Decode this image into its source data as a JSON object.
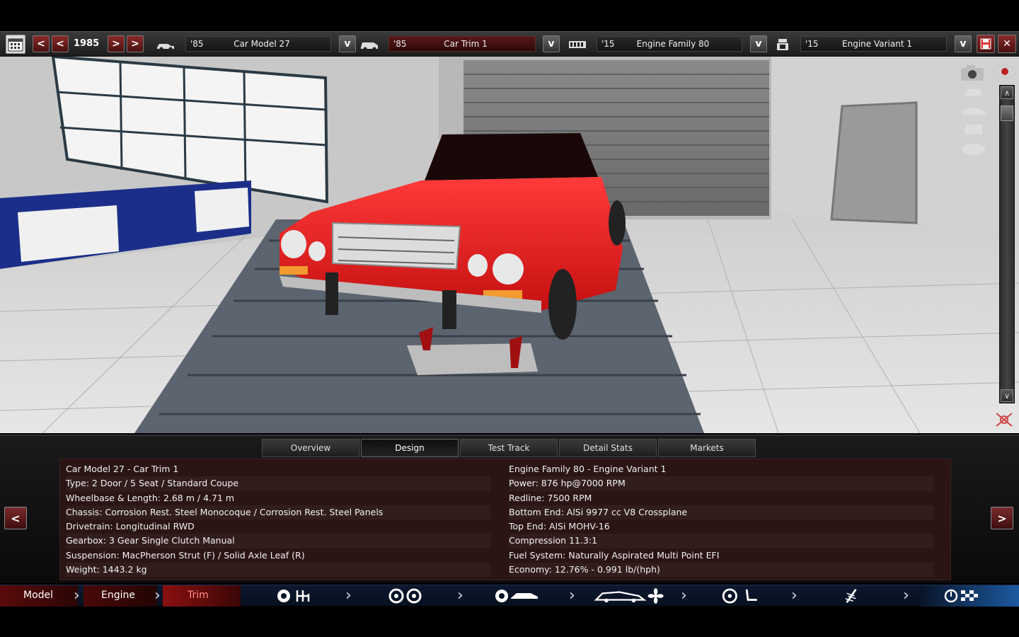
{
  "topbar": {
    "year": "1985",
    "model": {
      "year": "'85",
      "name": "Car Model 27"
    },
    "trim": {
      "year": "'85",
      "name": "Car Trim 1"
    },
    "engine_family": {
      "year": "'15",
      "name": "Engine Family 80"
    },
    "engine_variant": {
      "year": "'15",
      "name": "Engine Variant 1"
    }
  },
  "tabs": [
    {
      "label": "Overview"
    },
    {
      "label": "Design"
    },
    {
      "label": "Test Track"
    },
    {
      "label": "Detail Stats"
    },
    {
      "label": "Markets"
    }
  ],
  "info": {
    "left": [
      "Car Model 27 - Car Trim 1",
      "Type: 2 Door / 5 Seat / Standard Coupe",
      "Wheelbase & Length: 2.68 m / 4.71 m",
      "Chassis: Corrosion Rest. Steel Monocoque / Corrosion Rest. Steel Panels",
      "Drivetrain: Longitudinal RWD",
      "Gearbox: 3 Gear Single Clutch Manual",
      "Suspension: MacPherson Strut (F) / Solid Axle Leaf (R)",
      "Weight: 1443.2 kg"
    ],
    "right": [
      "Engine Family 80 - Engine Variant 1",
      "Power: 876 hp@7000 RPM",
      "Redline: 7500 RPM",
      "Bottom End: AlSi 9977 cc V8 Crossplane",
      "Top End: AlSi MOHV-16",
      "Compression 11.3:1",
      "Fuel System: Naturally Aspirated Multi Point EFI",
      "Economy: 12.76% - 0.991 lb/(hph)"
    ]
  },
  "bottomnav": {
    "model": "Model",
    "engine": "Engine",
    "trim": "Trim"
  },
  "colors": {
    "accent_red": "#c41a1a",
    "car_red": "#e81c1c",
    "panel_bg": "#2a1414",
    "nav_bg": "#0a1428"
  }
}
